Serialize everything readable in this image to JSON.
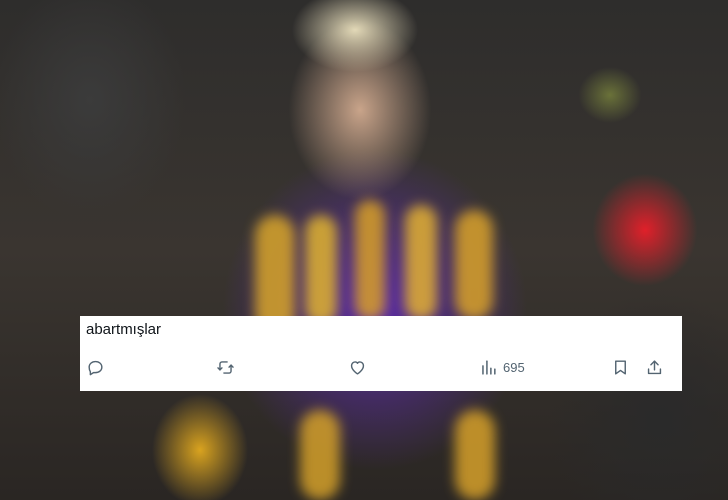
{
  "tweet": {
    "text": "abartmışlar",
    "views_count": "695"
  },
  "actions": {
    "reply_icon": "reply-icon",
    "retweet_icon": "retweet-icon",
    "like_icon": "heart-icon",
    "views_icon": "views-bar-chart-icon",
    "bookmark_icon": "bookmark-icon",
    "share_icon": "share-icon"
  },
  "colors": {
    "card_background": "#ffffff",
    "text": "#0f1419",
    "icon": "#536471"
  }
}
